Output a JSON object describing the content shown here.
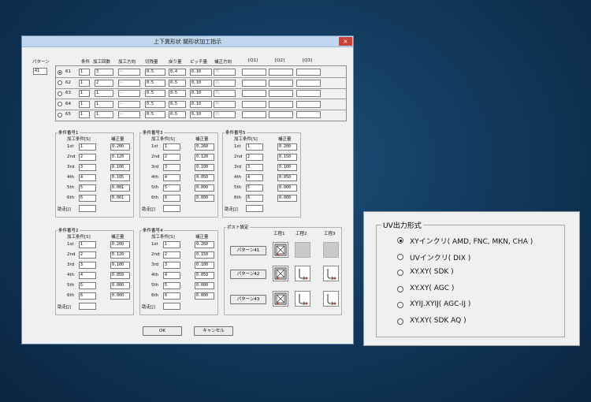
{
  "window": {
    "title": "上下異形状 閣形状加工指示",
    "close_label": "×",
    "pattern_label": "パターン",
    "pattern_value": "41"
  },
  "table": {
    "headers": [
      "条件",
      "加工回数",
      "加工方向",
      "切残量",
      "戻り量",
      "ピッチ量",
      "補正方向",
      "[Q1]",
      "[Q2]",
      "[Q3]"
    ],
    "rows": [
      {
        "label": "61",
        "selected": true,
        "cond": "1",
        "times": "3",
        "dir": "<-",
        "cut": "0.5",
        "ret": "0.4",
        "pitch": "0.10",
        "corr": "内"
      },
      {
        "label": "62",
        "selected": false,
        "cond": "1",
        "times": "2",
        "dir": "<-",
        "cut": "0.5",
        "ret": "0.5",
        "pitch": "0.10",
        "corr": "内"
      },
      {
        "label": "63",
        "selected": false,
        "cond": "1",
        "times": "1",
        "dir": "<-",
        "cut": "0.5",
        "ret": "0.5",
        "pitch": "0.10",
        "corr": "内"
      },
      {
        "label": "64",
        "selected": false,
        "cond": "1",
        "times": "1",
        "dir": "<-",
        "cut": "0.5",
        "ret": "0.5",
        "pitch": "0.10",
        "corr": "内"
      },
      {
        "label": "65",
        "selected": false,
        "cond": "1",
        "times": "1",
        "dir": "<-",
        "cut": "0.5",
        "ret": "0.5",
        "pitch": "0.10",
        "corr": "内"
      }
    ]
  },
  "cond_groups": [
    {
      "title": "条件番号1",
      "col1": "加工条件[S]",
      "col2": "補正量",
      "rows": [
        [
          "1st",
          "1",
          "0.200"
        ],
        [
          "2nd",
          "2",
          "0.120"
        ],
        [
          "3rd",
          "3",
          "0.100"
        ],
        [
          "4th",
          "4",
          "0.105"
        ],
        [
          "5th",
          "5",
          "0.001"
        ],
        [
          "6th",
          "6",
          "0.001"
        ]
      ],
      "assist": "助走[J]"
    },
    {
      "title": "条件番号3",
      "col1": "加工条件[S]",
      "col2": "補正量",
      "rows": [
        [
          "1st",
          "1",
          "0.260"
        ],
        [
          "2nd",
          "2",
          "0.120"
        ],
        [
          "3rd",
          "3",
          "0.100"
        ],
        [
          "4th",
          "4",
          "0.050"
        ],
        [
          "5th",
          "5",
          "0.000"
        ],
        [
          "6th",
          "6",
          "0.000"
        ]
      ],
      "assist": "助走[J]"
    },
    {
      "title": "条件番号5",
      "col1": "加工条件[S]",
      "col2": "補正量",
      "rows": [
        [
          "1st",
          "1",
          "0.200"
        ],
        [
          "2nd",
          "2",
          "0.150"
        ],
        [
          "3rd",
          "3",
          "0.100"
        ],
        [
          "4th",
          "4",
          "0.050"
        ],
        [
          "5th",
          "5",
          "0.000"
        ],
        [
          "6th",
          "6",
          "0.000"
        ]
      ],
      "assist": "助走[J]"
    },
    {
      "title": "条件番号2",
      "col1": "加工条件[S]",
      "col2": "補正量",
      "rows": [
        [
          "1st",
          "1",
          "0.200"
        ],
        [
          "2nd",
          "2",
          "0.120"
        ],
        [
          "3rd",
          "3",
          "0.100"
        ],
        [
          "4th",
          "4",
          "0.050"
        ],
        [
          "5th",
          "5",
          "0.000"
        ],
        [
          "6th",
          "6",
          "0.000"
        ]
      ],
      "assist": "助走[J]"
    },
    {
      "title": "条件番号4",
      "col1": "加工条件[S]",
      "col2": "補正量",
      "rows": [
        [
          "1st",
          "1",
          "0.260"
        ],
        [
          "2nd",
          "2",
          "0.150"
        ],
        [
          "3rd",
          "3",
          "0.100"
        ],
        [
          "4th",
          "4",
          "0.050"
        ],
        [
          "5th",
          "5",
          "0.000"
        ],
        [
          "6th",
          "6",
          "0.000"
        ]
      ],
      "assist": "助走[J]"
    }
  ],
  "post": {
    "title": "ポスト設定",
    "proc_headers": [
      "工程1",
      "工程2",
      "工程3"
    ],
    "buttons": [
      "パターン41",
      "パターン42",
      "パターン43"
    ]
  },
  "footer": {
    "ok": "OK",
    "cancel": "キャンセル"
  },
  "uv_panel": {
    "title": "UV出力形式",
    "options": [
      {
        "label": "XYインクリ( AMD, FNC, MKN, CHA )",
        "selected": true
      },
      {
        "label": "UVインクリ( DIX )",
        "selected": false
      },
      {
        "label": "XY.XY( SDK )",
        "selected": false
      },
      {
        "label": "XY.XY( AGC )",
        "selected": false
      },
      {
        "label": "XYIJ.XYIJ( AGC-IJ )",
        "selected": false
      },
      {
        "label": "XY.XY( SDK AQ )",
        "selected": false
      }
    ]
  }
}
